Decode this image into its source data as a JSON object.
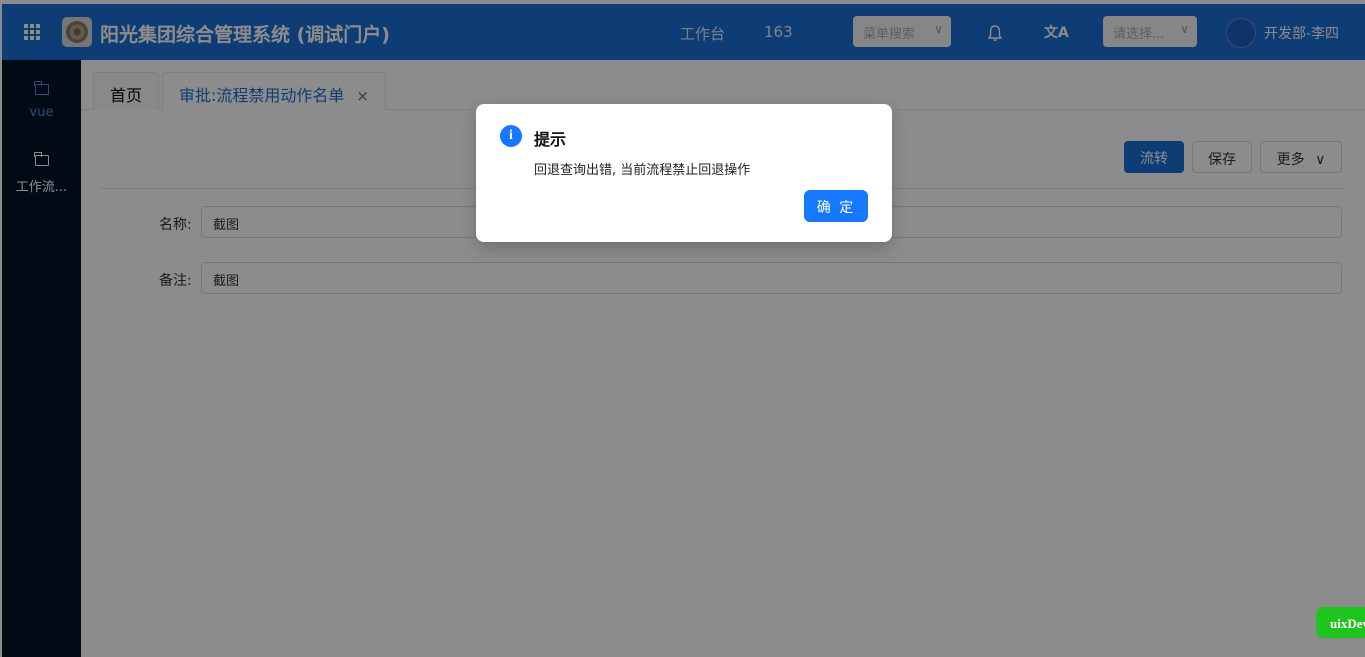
{
  "header": {
    "app_title": "阳光集团综合管理系统 (调试门户)",
    "workbench": "工作台",
    "count": "163",
    "menu_search_placeholder": "菜单搜索",
    "select_placeholder": "请选择...",
    "user": "开发部-李四",
    "translate_glyph": "文A"
  },
  "sidebar": {
    "items": [
      {
        "label": "vue",
        "active": true
      },
      {
        "label": "工作流..."
      }
    ]
  },
  "tabs": [
    {
      "label": "首页"
    },
    {
      "label": "审批:流程禁用动作名单",
      "close": "×",
      "active": true
    }
  ],
  "toolbar": {
    "flow_label": "流转",
    "save_label": "保存",
    "more_label": "更多"
  },
  "form": {
    "name_label": "名称:",
    "name_value": "截图",
    "remark_label": "备注:",
    "remark_value": "截图"
  },
  "modal": {
    "title": "提示",
    "content": "回退查询出错, 当前流程禁止回退操作",
    "ok_label": "确 定",
    "icon": "i"
  },
  "badge": {
    "label": "uixDev"
  },
  "colors": {
    "primary": "#1a6fd8",
    "sidebar": "#001529",
    "modal_button": "#1677ff",
    "badge": "#1fc41f"
  }
}
